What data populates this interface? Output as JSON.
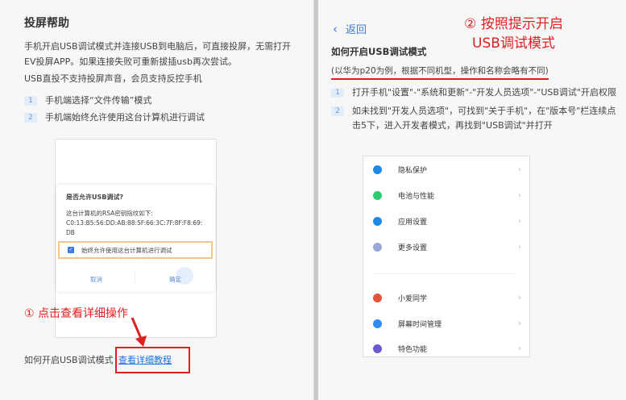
{
  "left": {
    "title": "投屏帮助",
    "desc1": "手机开启USB调试模式并连接USB到电脑后，可直接投屏，无需打开EV投屏APP。如果连接失败可重新拔插usb再次尝试。",
    "desc2": "USB直投不支持投屏声音，会员支持反控手机",
    "steps": [
      {
        "num": "1",
        "text": "手机端选择“文件传输”模式"
      },
      {
        "num": "2",
        "text": "手机端始终允许使用这台计算机进行调试"
      }
    ],
    "dialog": {
      "title": "是否允许USB调试?",
      "body": "这台计算机的RSA密钥指纹如下:",
      "fingerprint": "C0:13:B5:56:DD:AB:88:5F:66:3C:7F:8F:F8:69:DB",
      "checkbox": "始终允许使用这台计算机进行调试",
      "cancel": "取消",
      "ok": "确定"
    },
    "annotation": "① 点击查看详细操作",
    "footer_text": "如何开启USB调试模式",
    "footer_link": "查看详细教程"
  },
  "right": {
    "back": "返回",
    "annotation_line1": "② 按照提示开启",
    "annotation_line2": "USB调试模式",
    "title": "如何开启USB调试模式",
    "subtitle": "(以华为p20为例，根据不同机型，操作和名称会略有不同)",
    "steps": [
      {
        "num": "1",
        "text": "打开手机\"设置\"-\"系统和更新\"-\"开发人员选项\"-\"USB调试\"开启权限"
      },
      {
        "num": "2",
        "text": "如未找到\"开发人员选项\"，可找到\"关于手机\"，在\"版本号\"栏连续点击5下，进入开发者模式，再找到\"USB调试\"并打开"
      }
    ],
    "settings": [
      {
        "label": "隐私保护",
        "color": "#1e88e5"
      },
      {
        "label": "电池与性能",
        "color": "#2ecc71"
      },
      {
        "label": "应用设置",
        "color": "#1e88e5"
      },
      {
        "label": "更多设置",
        "color": "#9aa8d8"
      },
      {
        "label": "小爱同学",
        "color": "#e5533d"
      },
      {
        "label": "屏幕时间管理",
        "color": "#2f8cf0"
      },
      {
        "label": "特色功能",
        "color": "#6a5acd"
      }
    ]
  }
}
